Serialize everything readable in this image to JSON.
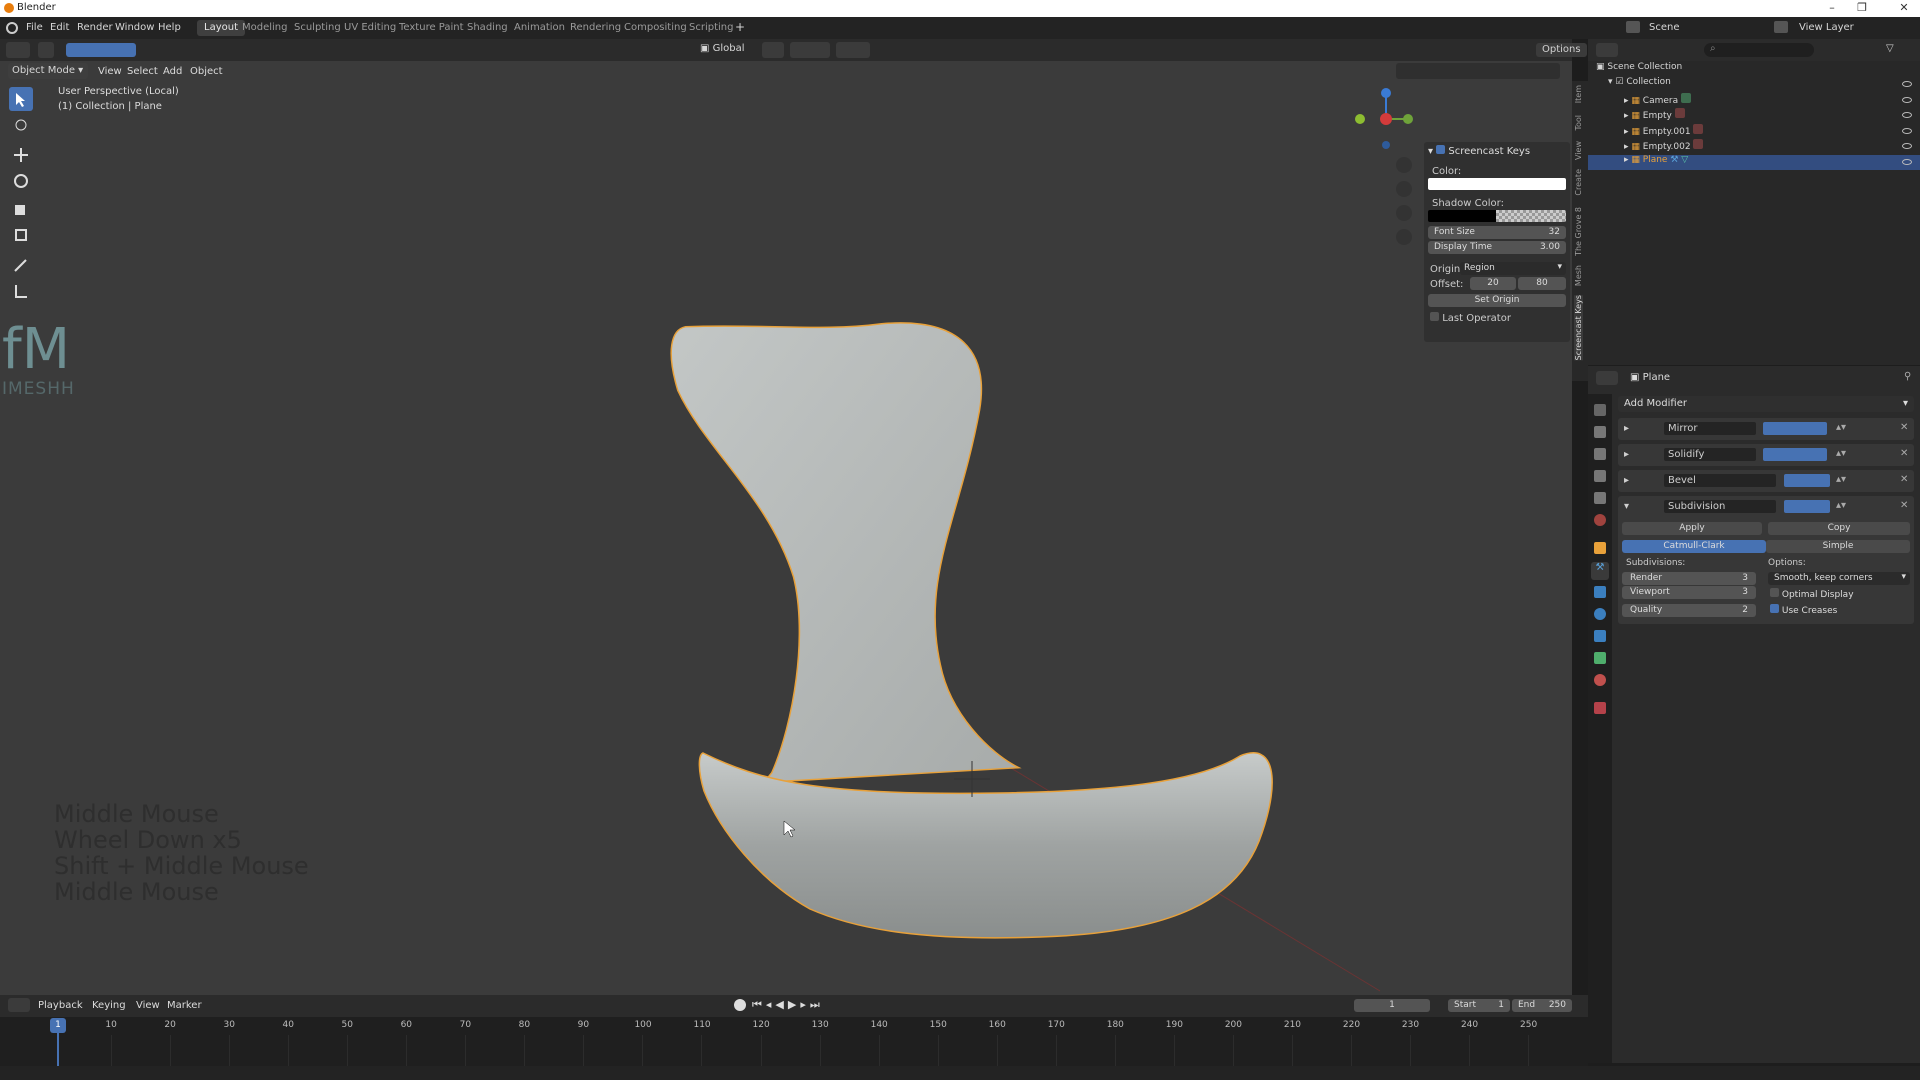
{
  "window": {
    "title": "Blender"
  },
  "menu": [
    "File",
    "Edit",
    "Render",
    "Window",
    "Help"
  ],
  "workspaces": [
    "Layout",
    "Modeling",
    "Sculpting",
    "UV Editing",
    "Texture Paint",
    "Shading",
    "Animation",
    "Rendering",
    "Compositing",
    "Scripting"
  ],
  "active_workspace": "Layout",
  "scene_name": "Scene",
  "view_layer": "View Layer",
  "header": {
    "mode": "Object Mode",
    "menus": [
      "View",
      "Select",
      "Add",
      "Object"
    ],
    "orientation": "Global",
    "options_label": "Options"
  },
  "viewport": {
    "info_line1": "User Perspective (Local)",
    "info_line2": "(1) Collection | Plane"
  },
  "watermark": {
    "logo_text": "fM",
    "brand": "IMESHH"
  },
  "screencast_overlay": [
    "Middle Mouse",
    "Wheel Down x5",
    "Shift + Middle Mouse",
    "Middle Mouse"
  ],
  "screencast_panel": {
    "title": "Screencast Keys",
    "color_label": "Color:",
    "shadow_color_label": "Shadow Color:",
    "font_size_label": "Font Size",
    "font_size": "32",
    "display_time_label": "Display Time",
    "display_time": "3.00",
    "origin_label": "Origin:",
    "origin_value": "Region",
    "offset_label": "Offset:",
    "offset_x": "20",
    "offset_y": "80",
    "set_origin": "Set Origin",
    "last_operator": "Last Operator"
  },
  "npanel_tabs": [
    "Item",
    "Tool",
    "View",
    "Create",
    "The Grove 8",
    "Mesh",
    "Screencast Keys"
  ],
  "outliner": {
    "root": "Scene Collection",
    "collection": "Collection",
    "items": [
      "Camera",
      "Empty",
      "Empty.001",
      "Empty.002",
      "Plane"
    ],
    "selected": "Plane"
  },
  "properties": {
    "object_name": "Plane",
    "add_modifier": "Add Modifier",
    "modifiers": [
      "Mirror",
      "Solidify",
      "Bevel",
      "Subdivision"
    ],
    "apply": "Apply",
    "copy": "Copy",
    "catmull": "Catmull-Clark",
    "simple": "Simple",
    "subdivisions_label": "Subdivisions:",
    "options_label": "Options:",
    "render_label": "Render",
    "render_value": "3",
    "viewport_label": "Viewport",
    "viewport_value": "3",
    "quality_label": "Quality",
    "quality_value": "2",
    "uv_smooth": "Smooth, keep corners",
    "optimal_display": "Optimal Display",
    "use_creases": "Use Creases"
  },
  "timeline": {
    "menus": [
      "Playback",
      "Keying",
      "View",
      "Marker"
    ],
    "current_frame": "1",
    "start_label": "Start",
    "start": "1",
    "end_label": "End",
    "end": "250",
    "ticks": [
      "1",
      "10",
      "20",
      "30",
      "40",
      "50",
      "60",
      "70",
      "80",
      "90",
      "100",
      "110",
      "120",
      "130",
      "140",
      "150",
      "160",
      "170",
      "180",
      "190",
      "200",
      "210",
      "220",
      "230",
      "240",
      "250"
    ]
  },
  "colors": {
    "accent": "#4772b3",
    "selection_outline": "#e8a13a",
    "viewport_bg": "#3b3b3b",
    "chair": "#b9bdbc"
  }
}
